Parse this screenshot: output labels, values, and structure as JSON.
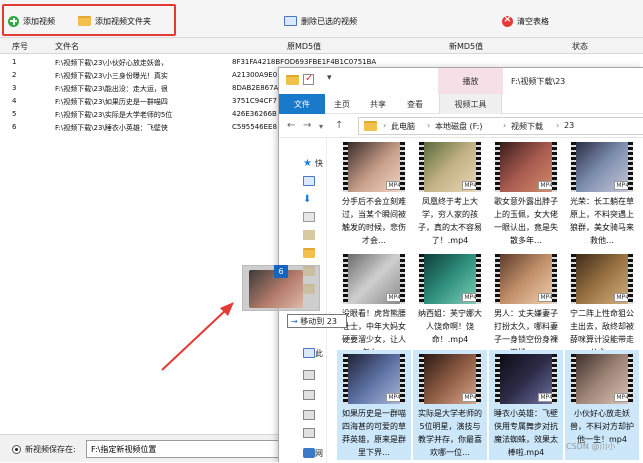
{
  "toolbar": {
    "add_video_label": "添加视频",
    "add_folder_label": "添加视频文件夹",
    "delete_selected_label": "删除已选的视频",
    "clear_table_label": "清空表格"
  },
  "table": {
    "headers": [
      "序号",
      "文件名",
      "原MD5值",
      "新MD5值",
      "状态"
    ],
    "rows": [
      {
        "no": "1",
        "file": "F:\\视频下载\\23\\小伙好心放走妖兽，",
        "md5": "8F31FA4218BFOD693FBE1F4B1C0751BA"
      },
      {
        "no": "2",
        "file": "F:\\视频下载\\23\\小三身份曝光！真实",
        "md5": "A21300A9E0"
      },
      {
        "no": "3",
        "file": "F:\\视频下载\\23\\能出没：走大运，很",
        "md5": "8DAB2E867A"
      },
      {
        "no": "4",
        "file": "F:\\视频下载\\23\\如果历史是一群喵四",
        "md5": "3751C94CF7"
      },
      {
        "no": "5",
        "file": "F:\\视频下载\\23\\实际是大学老师的5位",
        "md5": "426E36266B"
      },
      {
        "no": "6",
        "file": "F:\\视频下载\\23\\睡衣小英雄：飞壁侠",
        "md5": "C595546EE8"
      }
    ]
  },
  "footer": {
    "save_label": "新视频保存在:",
    "save_path": "F:\\指定新视频位置"
  },
  "explorer": {
    "title_path": "F:\\视频下载\\23",
    "manage_tab": "播放",
    "video_tools_tab": "视频工具",
    "ribbon_tabs": [
      "文件",
      "主页",
      "共享",
      "查看"
    ],
    "breadcrumb": [
      "此电脑",
      "本地磁盘 (F:)",
      "视频下载",
      "23"
    ],
    "sidebar_labels": [
      "快",
      "此",
      "网"
    ],
    "tiles": [
      {
        "caption": "分手后不会立刻难过，当某个瞬间被触发的时候，悲伤才会…"
      },
      {
        "caption": "凤凰终于考上大学，穷人家的孩子，真的太不容易了！.mp4"
      },
      {
        "caption": "歌女意外露出脖子上的玉佩，女大佬一眼认出，竟是失散多年…"
      },
      {
        "caption": "光荣：长工躺在草原上，不料突遇上狼群，美女骑马来救他…"
      },
      {
        "caption": "没眼看！虎背熊腰壮士，中年大妈女硬要溜少女，让人怎么…"
      },
      {
        "caption": "纳西姐：芙宁娜大人饶命啊！饶命！.mp4"
      },
      {
        "caption": "男人：丈夫嫌妻子打扮太久，哪料妻子一身锁空份身裸下楼，…"
      },
      {
        "caption": "宁二阵上性命狙公主出去，敌终却被薛咪算计没能带走公主…"
      },
      {
        "caption": "如果历史是一群喵四海甚的可爱的草莽英雄，原来是群里下界…"
      },
      {
        "caption": "实际是大学老师的5位明星，演技与教学并存，你最喜欢哪一位…"
      },
      {
        "caption": "睡衣小英雄：飞壁侠用专属舞步对抗魔法蜘蛛，效果太棒啦.mp4"
      },
      {
        "caption": "小伙好心放走妖兽，不料对方却护他一生！mp4"
      }
    ],
    "ghost_count": "6",
    "move_tip": "移动到 23"
  },
  "watermark": "CSDN @川小",
  "colors": {
    "accent": "#1979ca",
    "highlight_box": "#e53935",
    "selected_tile": "#cce6fa"
  }
}
